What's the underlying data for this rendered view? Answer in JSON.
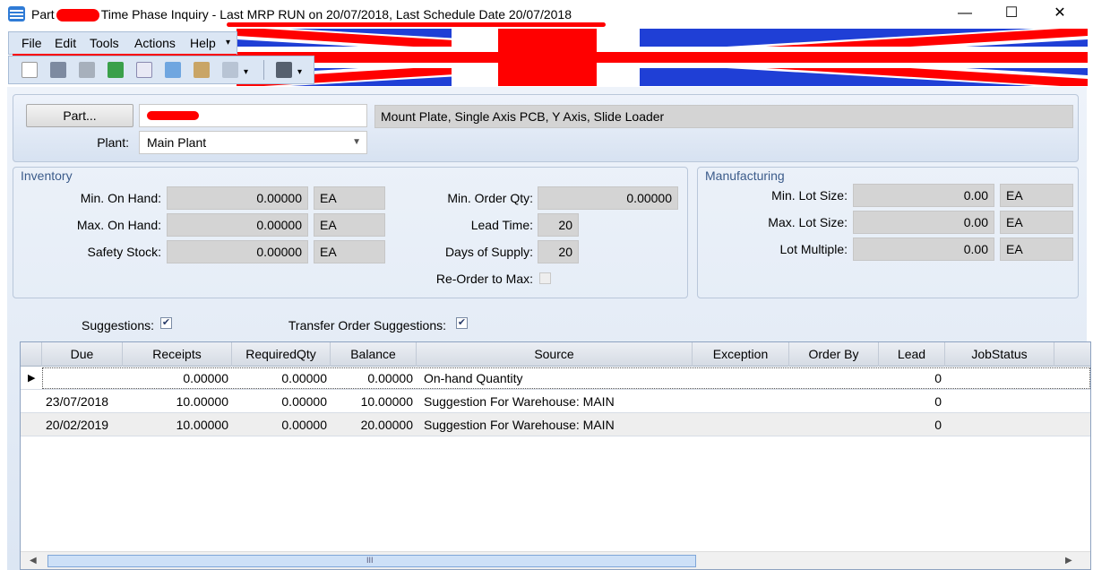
{
  "window": {
    "title_prefix": "Part",
    "title_mid": "Time Phase Inquiry",
    "title_suffix": " -  Last MRP RUN on 20/07/2018, Last Schedule Date  20/07/2018",
    "minimize": "—",
    "maximize": "☐",
    "close": "✕"
  },
  "menu": {
    "file": "File",
    "edit": "Edit",
    "tools": "Tools",
    "actions": "Actions",
    "help": "Help",
    "overflow": "▾"
  },
  "toolbar_icons": [
    "new-icon",
    "save-icon",
    "attach-icon",
    "refresh-icon",
    "clear-icon",
    "copy-icon",
    "paste-icon",
    "undo-icon",
    "search-binoculars-icon"
  ],
  "part": {
    "button": "Part...",
    "description": "Mount Plate, Single Axis PCB, Y Axis, Slide Loader",
    "plant_label": "Plant:",
    "plant_value": "Main Plant"
  },
  "inventory": {
    "title": "Inventory",
    "min_on_hand_label": "Min. On Hand:",
    "min_on_hand": "0.00000",
    "min_on_hand_uom": "EA",
    "max_on_hand_label": "Max. On Hand:",
    "max_on_hand": "0.00000",
    "max_on_hand_uom": "EA",
    "safety_stock_label": "Safety Stock:",
    "safety_stock": "0.00000",
    "safety_stock_uom": "EA",
    "min_order_qty_label": "Min. Order Qty:",
    "min_order_qty": "0.00000",
    "lead_time_label": "Lead Time:",
    "lead_time": "20",
    "days_of_supply_label": "Days of Supply:",
    "days_of_supply": "20",
    "reorder_to_max_label": "Re-Order to Max:"
  },
  "manufacturing": {
    "title": "Manufacturing",
    "min_lot_size_label": "Min. Lot Size:",
    "min_lot_size": "0.00",
    "min_lot_size_uom": "EA",
    "max_lot_size_label": "Max. Lot Size:",
    "max_lot_size": "0.00",
    "max_lot_size_uom": "EA",
    "lot_multiple_label": "Lot Multiple:",
    "lot_multiple": "0.00",
    "lot_multiple_uom": "EA"
  },
  "options": {
    "suggestions_label": "Suggestions:",
    "suggestions_checked": true,
    "transfer_label": "Transfer Order Suggestions:",
    "transfer_checked": true
  },
  "grid": {
    "columns": [
      "Due",
      "Receipts",
      "RequiredQty",
      "Balance",
      "Source",
      "Exception",
      "Order By",
      "Lead",
      "JobStatus"
    ],
    "rows": [
      {
        "due": "",
        "receipts": "0.00000",
        "required": "0.00000",
        "balance": "0.00000",
        "source": "On-hand Quantity",
        "exception": "",
        "order_by": "",
        "lead": "0",
        "job_status": ""
      },
      {
        "due": "23/07/2018",
        "receipts": "10.00000",
        "required": "0.00000",
        "balance": "10.00000",
        "source": "Suggestion For Warehouse: MAIN",
        "exception": "",
        "order_by": "",
        "lead": "0",
        "job_status": ""
      },
      {
        "due": "20/02/2019",
        "receipts": "10.00000",
        "required": "0.00000",
        "balance": "20.00000",
        "source": "Suggestion For Warehouse: MAIN",
        "exception": "",
        "order_by": "",
        "lead": "0",
        "job_status": ""
      }
    ],
    "scroll_grip": "III"
  },
  "colors": {
    "flag_blue": "#1f3fd6",
    "flag_red": "#ff0000",
    "accent_title": "#3b5b8a"
  }
}
